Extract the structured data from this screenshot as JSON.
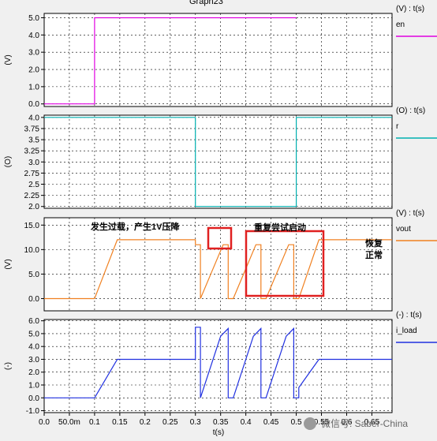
{
  "window": {
    "title": "Graph23"
  },
  "chart_data": [
    {
      "type": "line",
      "ylabel": "(V)",
      "axis_header": "(V) : t(s)",
      "series": [
        {
          "name": "en",
          "color": "#e000e0",
          "x": [
            0,
            0.1,
            0.1,
            0.5
          ],
          "y": [
            0,
            0,
            5,
            5
          ]
        }
      ],
      "yticks": [
        "0.0",
        "1.0",
        "2.0",
        "3.0",
        "4.0",
        "5.0"
      ],
      "ylim": [
        -0.15,
        5.25
      ],
      "grid": true
    },
    {
      "type": "line",
      "ylabel": "(O)",
      "axis_header": "(O) : t(s)",
      "series": [
        {
          "name": "r",
          "color": "#00b0b0",
          "x": [
            0,
            0.3,
            0.3,
            0.5,
            0.5,
            0.69
          ],
          "y": [
            4,
            4,
            2,
            2,
            4,
            4
          ]
        }
      ],
      "yticks": [
        "2.0",
        "2.25",
        "2.5",
        "2.75",
        "3.0",
        "3.25",
        "3.5",
        "3.75",
        "4.0"
      ],
      "ylim": [
        1.96,
        4.05
      ],
      "grid": true
    },
    {
      "type": "line",
      "ylabel": "(V)",
      "axis_header": "(V) : t(s)",
      "series": [
        {
          "name": "vout",
          "color": "#f08020",
          "x": [
            0,
            0.1,
            0.145,
            0.3,
            0.3,
            0.31,
            0.31,
            0.355,
            0.365,
            0.365,
            0.375,
            0.375,
            0.42,
            0.43,
            0.43,
            0.44,
            0.44,
            0.485,
            0.495,
            0.495,
            0.505,
            0.505,
            0.545,
            0.69
          ],
          "y": [
            0,
            0,
            12,
            12,
            11,
            11,
            0,
            11,
            11,
            0,
            0,
            0,
            11,
            11,
            0,
            0,
            0,
            11,
            11,
            0,
            0,
            0,
            12,
            12
          ]
        }
      ],
      "yticks": [
        "0.0",
        "5.0",
        "10.0",
        "15.0"
      ],
      "ylim": [
        -2.5,
        16.5
      ],
      "grid": true
    },
    {
      "type": "line",
      "ylabel": "(-)",
      "axis_header": "(-) : t(s)",
      "series": [
        {
          "name": "i_load",
          "color": "#2030e0",
          "x": [
            0,
            0.1,
            0.145,
            0.3,
            0.3,
            0.31,
            0.31,
            0.35,
            0.365,
            0.365,
            0.375,
            0.375,
            0.415,
            0.43,
            0.43,
            0.44,
            0.44,
            0.48,
            0.495,
            0.495,
            0.505,
            0.505,
            0.545,
            0.69
          ],
          "y": [
            0,
            0,
            3,
            3,
            5.5,
            5.5,
            0,
            4.8,
            5.4,
            0,
            0,
            0,
            4.8,
            5.4,
            0,
            0,
            0,
            4.8,
            5.4,
            0,
            0,
            0.8,
            3,
            3
          ]
        }
      ],
      "yticks": [
        "-1.0",
        "0.0",
        "1.0",
        "2.0",
        "3.0",
        "4.0",
        "5.0",
        "6.0"
      ],
      "ylim": [
        -1.15,
        6.1
      ],
      "grid": true
    }
  ],
  "x_axis": {
    "label": "t(s)",
    "xlim": [
      0,
      0.69
    ],
    "tick_values": [
      0,
      0.05,
      0.1,
      0.15,
      0.2,
      0.25,
      0.3,
      0.35,
      0.4,
      0.45,
      0.5,
      0.55,
      0.6,
      0.65
    ],
    "tick_labels": [
      "0.0",
      "50.0m",
      "0.1",
      "0.15",
      "0.2",
      "0.25",
      "0.3",
      "0.35",
      "0.4",
      "0.45",
      "0.5",
      "0.55",
      "0.6",
      "0.65"
    ]
  },
  "annotations": {
    "overload": "发生过载，产生1V压降",
    "retry": "重复尝试启动",
    "recover_1": "恢复",
    "recover_2": "正常"
  },
  "colors": {
    "highlight_box": "#e02020"
  },
  "watermark": "微信号: Saber-China"
}
